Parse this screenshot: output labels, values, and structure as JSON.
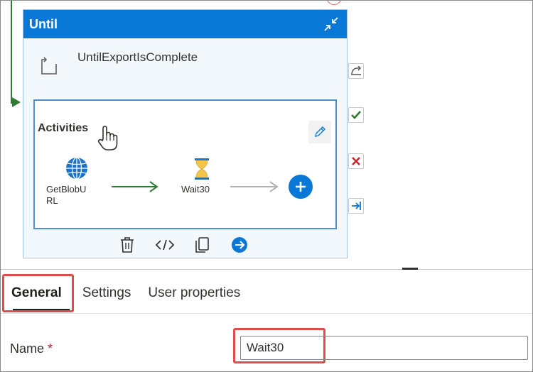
{
  "canvas": {
    "until": {
      "title": "Until",
      "activity_name": "UntilExportIsComplete",
      "activities_label": "Activities",
      "nodes": [
        {
          "label": "GetBlobURL",
          "icon": "globe-icon"
        },
        {
          "label": "Wait30",
          "icon": "hourglass-icon"
        }
      ],
      "toolbar": [
        "delete-icon",
        "code-icon",
        "copy-icon",
        "arrow-right-circle-icon"
      ]
    },
    "side_connectors": [
      "skip-icon",
      "success-icon",
      "failure-icon",
      "completion-icon"
    ]
  },
  "tabs": [
    {
      "label": "General",
      "active": true
    },
    {
      "label": "Settings",
      "active": false
    },
    {
      "label": "User properties",
      "active": false
    }
  ],
  "form": {
    "name_label": "Name",
    "required_marker": "*",
    "name_value": "Wait30"
  },
  "colors": {
    "accent": "#0a78d7",
    "success": "#2e7d32",
    "highlight": "#e04c4c"
  }
}
